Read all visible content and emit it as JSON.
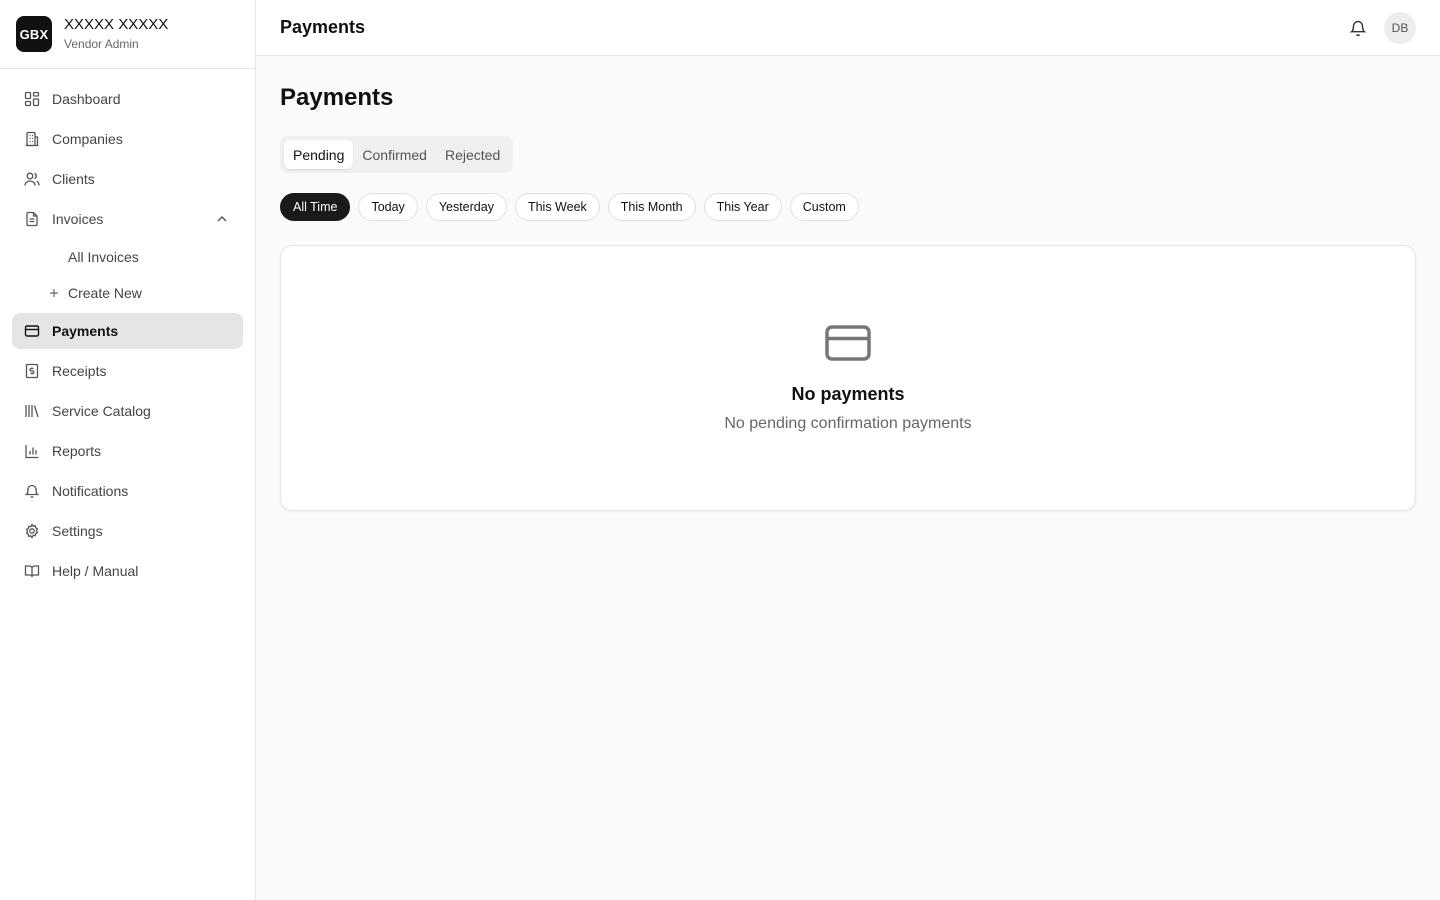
{
  "brand": {
    "logo_text": "GBX",
    "name": "XXXXX XXXXX",
    "role": "Vendor Admin"
  },
  "sidebar": {
    "items": [
      {
        "label": "Dashboard",
        "icon": "dashboard-icon"
      },
      {
        "label": "Companies",
        "icon": "building-icon"
      },
      {
        "label": "Clients",
        "icon": "users-icon"
      },
      {
        "label": "Invoices",
        "icon": "file-icon",
        "expanded": true
      },
      {
        "label": "Payments",
        "icon": "credit-card-icon",
        "active": true
      },
      {
        "label": "Receipts",
        "icon": "receipt-icon"
      },
      {
        "label": "Service Catalog",
        "icon": "library-icon"
      },
      {
        "label": "Reports",
        "icon": "bar-chart-icon"
      },
      {
        "label": "Notifications",
        "icon": "bell-icon"
      },
      {
        "label": "Settings",
        "icon": "gear-icon"
      },
      {
        "label": "Help / Manual",
        "icon": "book-icon"
      }
    ],
    "invoices_sub": {
      "all": "All Invoices",
      "create": "Create New"
    }
  },
  "header": {
    "title": "Payments",
    "avatar_initials": "DB"
  },
  "main": {
    "title": "Payments",
    "tabs": [
      {
        "label": "Pending",
        "active": true
      },
      {
        "label": "Confirmed"
      },
      {
        "label": "Rejected"
      }
    ],
    "filters": [
      {
        "label": "All Time",
        "active": true
      },
      {
        "label": "Today"
      },
      {
        "label": "Yesterday"
      },
      {
        "label": "This Week"
      },
      {
        "label": "This Month"
      },
      {
        "label": "This Year"
      },
      {
        "label": "Custom"
      }
    ],
    "empty": {
      "title": "No payments",
      "subtitle": "No pending confirmation payments"
    }
  }
}
